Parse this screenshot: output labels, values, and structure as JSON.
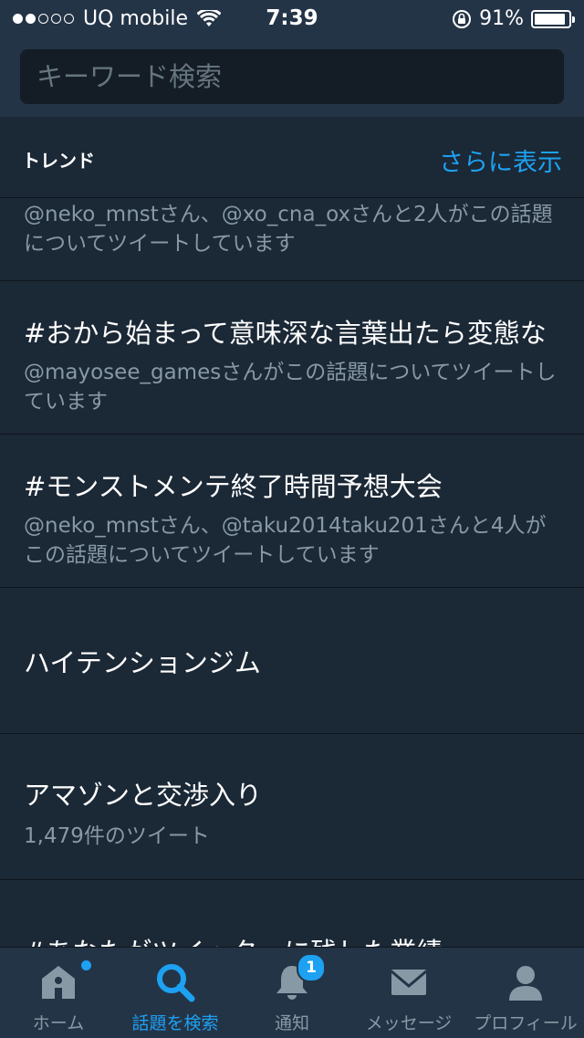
{
  "status_bar": {
    "carrier": "UQ mobile",
    "time": "7:39",
    "battery_percent": "91%",
    "signal_bars": 2,
    "signal_total": 5,
    "battery_level": 0.91
  },
  "search": {
    "placeholder": "キーワード検索"
  },
  "trends": {
    "title": "トレンド",
    "show_more": "さらに表示",
    "items": [
      {
        "name": "",
        "meta": "@neko_mnstさん、@xo_cna_oxさんと2人がこの話題についてツイートしています"
      },
      {
        "name": "#おから始まって意味深な言葉出たら変態な",
        "meta": "@mayosee_gamesさんがこの話題についてツイートしています"
      },
      {
        "name": "#モンストメンテ終了時間予想大会",
        "meta": "@neko_mnstさん、@taku2014taku201さんと4人がこの話題についてツイートしています"
      },
      {
        "name": "ハイテンションジム",
        "meta": ""
      },
      {
        "name": "アマゾンと交渉入り",
        "meta": "1,479件のツイート"
      },
      {
        "name": "#あなたがツイッターに残した業績",
        "meta": ""
      }
    ]
  },
  "tabbar": {
    "home": "ホーム",
    "search": "話題を検索",
    "notifications": "通知",
    "notifications_badge": "1",
    "messages": "メッセージ",
    "profile": "プロフィール"
  },
  "colors": {
    "background": "#1b2836",
    "bar": "#243447",
    "accent": "#1da1f2",
    "secondary_text": "#8899a6"
  }
}
